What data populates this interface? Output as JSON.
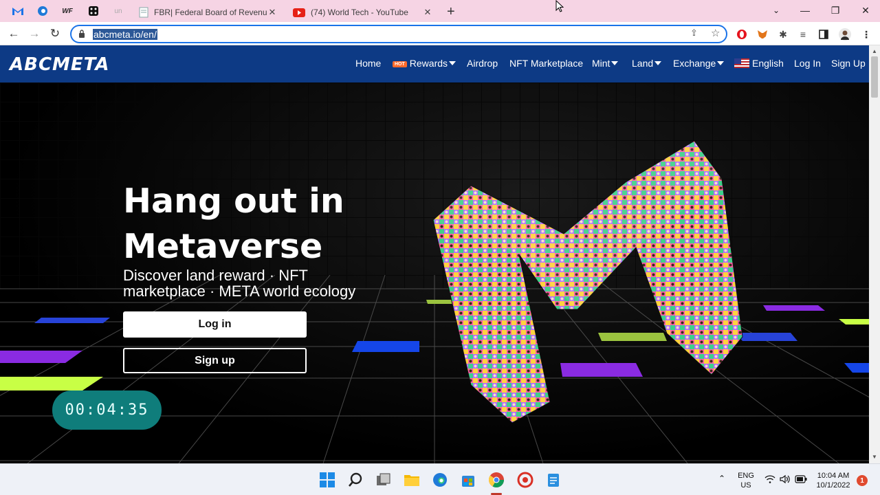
{
  "browser": {
    "pinned_tabs": [
      {
        "icon": "gmail-icon",
        "color": "#1a73e8"
      },
      {
        "icon": "edge-icon",
        "color": "#1f7ad8"
      },
      {
        "icon": "wf-icon",
        "label": "WF",
        "color": "#222"
      },
      {
        "icon": "dice-icon",
        "color": "#111"
      },
      {
        "icon": "un-icon",
        "label": "un",
        "color": "#aaa"
      }
    ],
    "tabs": [
      {
        "title": "FBR| Federal Board of Revenue -",
        "icon": "document-icon"
      },
      {
        "title": "(74) World Tech - YouTube",
        "icon": "youtube-icon",
        "active": true
      }
    ],
    "url": "abcmeta.io/en/"
  },
  "site": {
    "logo": "ABCMETA",
    "nav": {
      "home": "Home",
      "hot_badge": "HOT",
      "rewards": "Rewards",
      "airdrop": "Airdrop",
      "nft_marketplace": "NFT Marketplace",
      "mint": "Mint",
      "land": "Land",
      "exchange": "Exchange",
      "language": "English",
      "login": "Log In",
      "signup": "Sign Up"
    },
    "hero": {
      "title": "Hang out in Metaverse",
      "subtitle": "Discover land reward · NFT marketplace · META world ecology",
      "login_button": "Log in",
      "signup_button": "Sign up"
    },
    "accent_color": "#0d3a85"
  },
  "overlay": {
    "timer": "00:04:35"
  },
  "taskbar": {
    "language_line1": "ENG",
    "language_line2": "US",
    "time": "10:04 AM",
    "date": "10/1/2022",
    "notification_count": "1"
  }
}
